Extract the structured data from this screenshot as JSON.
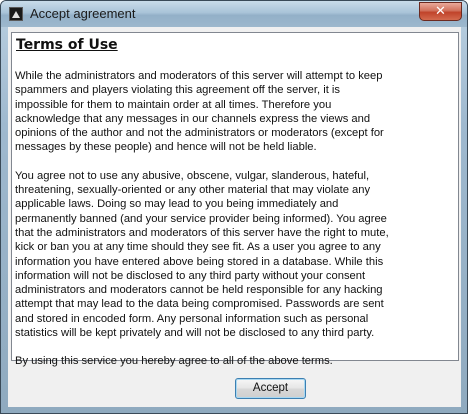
{
  "window": {
    "title": "Accept agreement",
    "close_label": "✕"
  },
  "agreement": {
    "heading": "Terms of Use",
    "paragraphs": [
      [
        "While the administrators and moderators of this server will attempt to keep",
        "spammers and players violating this agreement off the server, it is",
        "impossible for them to maintain order at all times. Therefore you",
        "acknowledge that any messages in our channels express the views and",
        "opinions of the author and not the administrators or moderators (except for",
        "messages by these people) and hence will not be held liable."
      ],
      [
        "You agree not to use any abusive, obscene, vulgar, slanderous, hateful,",
        "threatening, sexually-oriented or any other material that may violate any",
        "applicable laws. Doing so may lead to you being immediately and",
        "permanently banned (and your service provider being informed). You agree",
        "that the administrators and moderators of this server have the right to mute,",
        "kick or ban you at any time should they see fit. As a user you agree to any",
        "information you have entered above being stored in a database. While this",
        "information will not be disclosed to any third party without your consent",
        "administrators and moderators cannot be held responsible for any hacking",
        "attempt that may lead to the data being compromised. Passwords are sent",
        "and stored in encoded form. Any personal information such as personal",
        "statistics will be kept privately and will not be disclosed to any third party."
      ],
      [
        "By using this service you hereby agree to all of the above terms."
      ]
    ]
  },
  "buttons": {
    "accept_label": "Accept"
  },
  "colors": {
    "close_button": "#c0432a",
    "accept_border": "#3c7fb1"
  }
}
